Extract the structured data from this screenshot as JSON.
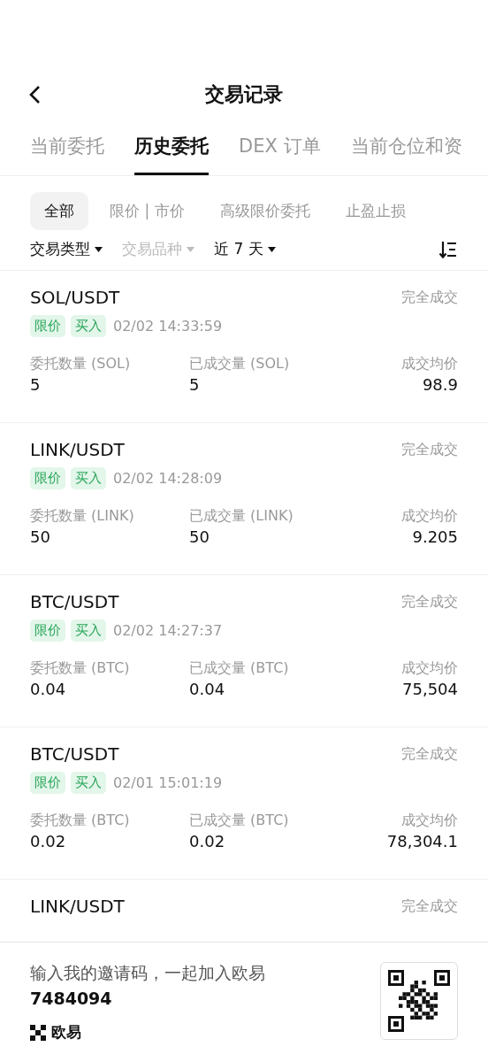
{
  "header": {
    "title": "交易记录"
  },
  "tabs": [
    {
      "label": "当前委托",
      "selected": false
    },
    {
      "label": "历史委托",
      "selected": true
    },
    {
      "label": "DEX 订单",
      "selected": false
    },
    {
      "label": "当前仓位和资",
      "selected": false
    }
  ],
  "chips": [
    {
      "label": "全部",
      "selected": true
    },
    {
      "label": "限价 | 市价",
      "selected": false
    },
    {
      "label": "高级限价委托",
      "selected": false
    },
    {
      "label": "止盈止损",
      "selected": false
    }
  ],
  "filters": [
    {
      "label": "交易类型",
      "disabled": false
    },
    {
      "label": "交易品种",
      "disabled": true
    },
    {
      "label": "近 7 天",
      "disabled": false
    }
  ],
  "orders": [
    {
      "pair": "SOL/USDT",
      "status": "完全成交",
      "tags": [
        "限价",
        "买入"
      ],
      "time": "02/02 14:33:59",
      "fields": [
        {
          "label": "委托数量 (SOL)",
          "value": "5"
        },
        {
          "label": "已成交量 (SOL)",
          "value": "5"
        },
        {
          "label": "成交均价",
          "value": "98.9"
        }
      ]
    },
    {
      "pair": "LINK/USDT",
      "status": "完全成交",
      "tags": [
        "限价",
        "买入"
      ],
      "time": "02/02 14:28:09",
      "fields": [
        {
          "label": "委托数量 (LINK)",
          "value": "50"
        },
        {
          "label": "已成交量 (LINK)",
          "value": "50"
        },
        {
          "label": "成交均价",
          "value": "9.205"
        }
      ]
    },
    {
      "pair": "BTC/USDT",
      "status": "完全成交",
      "tags": [
        "限价",
        "买入"
      ],
      "time": "02/02 14:27:37",
      "fields": [
        {
          "label": "委托数量 (BTC)",
          "value": "0.04"
        },
        {
          "label": "已成交量 (BTC)",
          "value": "0.04"
        },
        {
          "label": "成交均价",
          "value": "75,504"
        }
      ]
    },
    {
      "pair": "BTC/USDT",
      "status": "完全成交",
      "tags": [
        "限价",
        "买入"
      ],
      "time": "02/01 15:01:19",
      "fields": [
        {
          "label": "委托数量 (BTC)",
          "value": "0.02"
        },
        {
          "label": "已成交量 (BTC)",
          "value": "0.02"
        },
        {
          "label": "成交均价",
          "value": "78,304.1"
        }
      ]
    },
    {
      "pair": "LINK/USDT",
      "status": "完全成交"
    }
  ],
  "invite": {
    "text": "输入我的邀请码，一起加入欧易",
    "code": "7484094",
    "brand": "欧易"
  }
}
